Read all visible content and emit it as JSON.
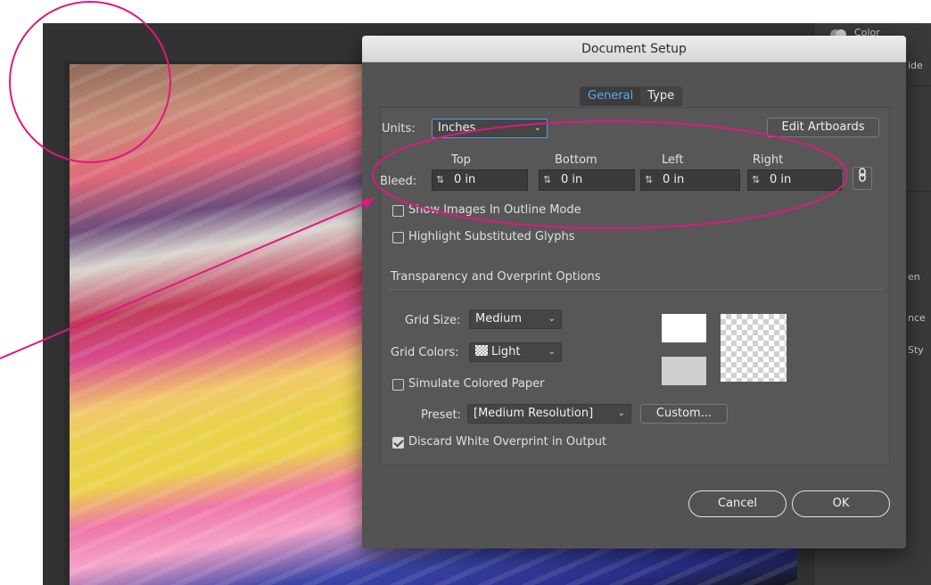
{
  "right_panel": {
    "color_label": "Color",
    "fragments": [
      "ide",
      "en",
      "nce",
      "Sty"
    ]
  },
  "dialog": {
    "title": "Document Setup",
    "tabs": [
      {
        "label": "General",
        "active": true
      },
      {
        "label": "Type",
        "active": false
      }
    ],
    "units": {
      "label": "Units:",
      "value": "Inches"
    },
    "edit_artboards_label": "Edit Artboards",
    "bleed": {
      "label": "Bleed:",
      "columns": [
        {
          "header": "Top",
          "value": "0 in"
        },
        {
          "header": "Bottom",
          "value": "0 in"
        },
        {
          "header": "Left",
          "value": "0 in"
        },
        {
          "header": "Right",
          "value": "0 in"
        }
      ]
    },
    "show_images_outline": {
      "label": "Show Images In Outline Mode",
      "checked": false
    },
    "highlight_glyphs": {
      "label": "Highlight Substituted Glyphs",
      "checked": false
    },
    "transparency_section_title": "Transparency and Overprint Options",
    "grid_size": {
      "label": "Grid Size:",
      "value": "Medium"
    },
    "grid_colors": {
      "label": "Grid Colors:",
      "value": "Light"
    },
    "simulate_paper": {
      "label": "Simulate Colored Paper",
      "checked": false
    },
    "preset": {
      "label": "Preset:",
      "value": "[Medium Resolution]"
    },
    "custom_label": "Custom...",
    "discard_white": {
      "label": "Discard White Overprint in Output",
      "checked": true
    },
    "cancel_label": "Cancel",
    "ok_label": "OK"
  },
  "colors": {
    "accent_tab": "#5cacef",
    "annotation_magenta": "#e0187f",
    "dialog_bg": "#535353",
    "swatch_white": "#ffffff",
    "swatch_gray": "#cfcfcf"
  }
}
